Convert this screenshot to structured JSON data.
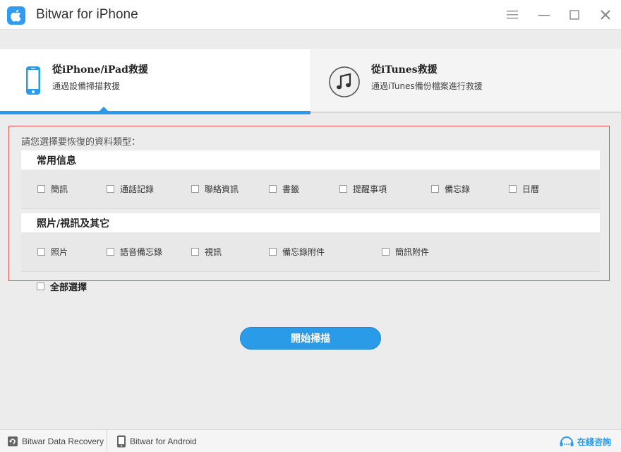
{
  "window": {
    "title": "Bitwar for iPhone"
  },
  "tabs": [
    {
      "title": "從iPhone/iPad救援",
      "subtitle": "通過設備掃描救援",
      "icon": "iphone-icon"
    },
    {
      "title": "從iTunes救援",
      "subtitle": "通過iTunes備份檔案進行救援",
      "icon": "music-note-icon"
    }
  ],
  "selection": {
    "prompt": "請您選擇要恢復的資料類型：",
    "groups": [
      {
        "title": "常用信息",
        "options": [
          {
            "label": "簡訊",
            "checked": false
          },
          {
            "label": "通話記錄",
            "checked": false
          },
          {
            "label": "聯絡資訊",
            "checked": false
          },
          {
            "label": "書籤",
            "checked": false
          },
          {
            "label": "提醒事項",
            "checked": false
          },
          {
            "label": "備忘錄",
            "checked": false
          },
          {
            "label": "日曆",
            "checked": false
          }
        ]
      },
      {
        "title": "照片/視訊及其它",
        "options": [
          {
            "label": "照片",
            "checked": false
          },
          {
            "label": "語音備忘錄",
            "checked": false
          },
          {
            "label": "視訊",
            "checked": false
          },
          {
            "label": "備忘錄附件",
            "checked": false
          },
          {
            "label": "簡訊附件",
            "checked": false
          }
        ]
      }
    ],
    "select_all_label": "全部選擇"
  },
  "scan_button": {
    "label": "開始掃描"
  },
  "footer": {
    "items": [
      {
        "label": "Bitwar Data Recovery",
        "icon": "data-recovery-icon"
      },
      {
        "label": "Bitwar for Android",
        "icon": "android-phone-icon"
      }
    ],
    "consult_label": "在綫咨詢"
  },
  "colors": {
    "accent": "#2a9be8",
    "panel_border": "#d9534f",
    "background": "#ececec"
  }
}
